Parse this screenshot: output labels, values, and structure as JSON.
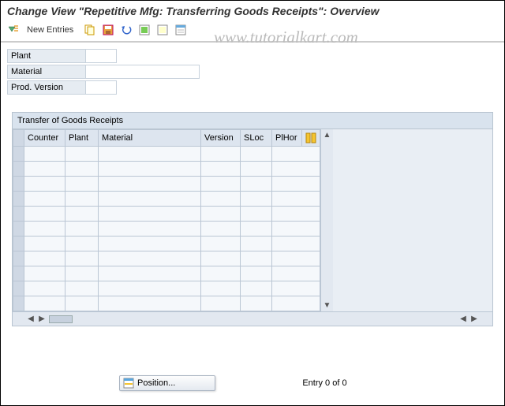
{
  "title": "Change View \"Repetitive Mfg: Transferring Goods Receipts\": Overview",
  "watermark": "www.tutorialkart.com",
  "toolbar": {
    "new_entries": "New Entries"
  },
  "form": {
    "plant_label": "Plant",
    "plant_value": "",
    "material_label": "Material",
    "material_value": "",
    "prodver_label": "Prod. Version",
    "prodver_value": ""
  },
  "panel": {
    "title": "Transfer of Goods Receipts",
    "columns": {
      "counter": "Counter",
      "plant": "Plant",
      "material": "Material",
      "version": "Version",
      "sloc": "SLoc",
      "plhor": "PlHor"
    },
    "rows": [
      {
        "counter": "",
        "plant": "",
        "material": "",
        "version": "",
        "sloc": "",
        "plhor": ""
      },
      {
        "counter": "",
        "plant": "",
        "material": "",
        "version": "",
        "sloc": "",
        "plhor": ""
      },
      {
        "counter": "",
        "plant": "",
        "material": "",
        "version": "",
        "sloc": "",
        "plhor": ""
      },
      {
        "counter": "",
        "plant": "",
        "material": "",
        "version": "",
        "sloc": "",
        "plhor": ""
      },
      {
        "counter": "",
        "plant": "",
        "material": "",
        "version": "",
        "sloc": "",
        "plhor": ""
      },
      {
        "counter": "",
        "plant": "",
        "material": "",
        "version": "",
        "sloc": "",
        "plhor": ""
      },
      {
        "counter": "",
        "plant": "",
        "material": "",
        "version": "",
        "sloc": "",
        "plhor": ""
      },
      {
        "counter": "",
        "plant": "",
        "material": "",
        "version": "",
        "sloc": "",
        "plhor": ""
      },
      {
        "counter": "",
        "plant": "",
        "material": "",
        "version": "",
        "sloc": "",
        "plhor": ""
      },
      {
        "counter": "",
        "plant": "",
        "material": "",
        "version": "",
        "sloc": "",
        "plhor": ""
      },
      {
        "counter": "",
        "plant": "",
        "material": "",
        "version": "",
        "sloc": "",
        "plhor": ""
      }
    ]
  },
  "footer": {
    "position_label": "Position...",
    "entry_text": "Entry 0 of 0"
  }
}
